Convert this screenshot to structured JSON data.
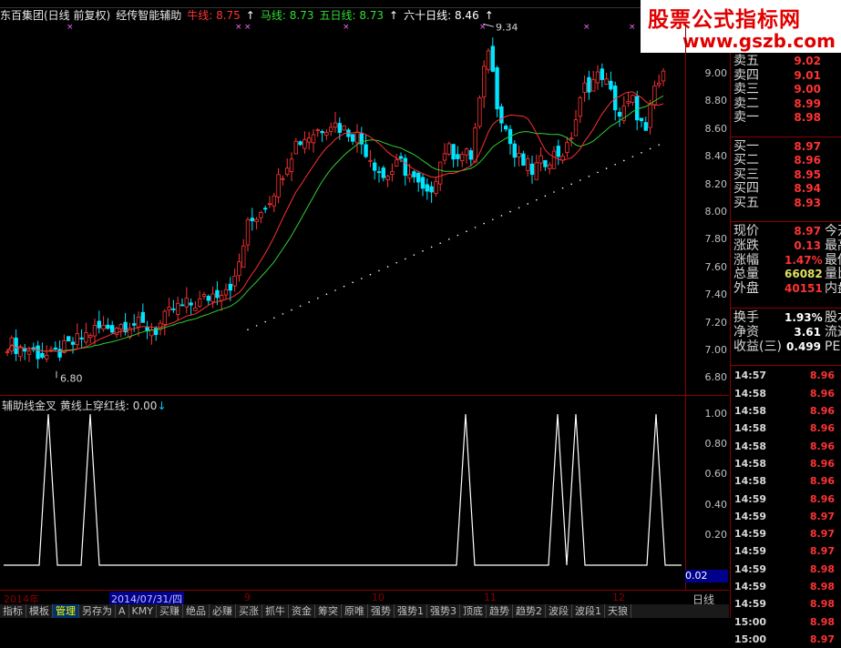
{
  "header": {
    "stock_name": "东百集团(日线 前复权)",
    "indicator_name": "经传智能辅助",
    "niu_label": "牛线:",
    "niu_value": "8.75",
    "ma_label": "马线:",
    "ma_value": "8.73",
    "wu_label": "五日线:",
    "wu_value": "8.73",
    "liushi_label": "六十日线:",
    "liushi_value": "8.46"
  },
  "watermark": {
    "line1": "股票公式指标网",
    "line2": "www.gszb.com"
  },
  "main_chart": {
    "price_axis": [
      "9.00",
      "8.80",
      "8.60",
      "8.40",
      "8.20",
      "8.00",
      "7.80",
      "7.60",
      "7.40",
      "7.20",
      "7.00",
      "6.80"
    ],
    "high_label": "9.34",
    "low_label": "6.80"
  },
  "sub_chart": {
    "title": "辅助线金叉",
    "line_label": "黄线上穿红线:",
    "line_value": "0.00",
    "axis": [
      "1.00",
      "0.80",
      "0.60",
      "0.40",
      "0.20"
    ],
    "current": "0.02"
  },
  "date_bar": {
    "year": "2014年",
    "cursor_date": "2014/07/31/四",
    "months": [
      "9",
      "10",
      "11",
      "12"
    ],
    "period": "日线"
  },
  "tabs": [
    "指标",
    "模板",
    "管理",
    "另存为",
    "A",
    "KMY",
    "买赚",
    "绝品",
    "必赚",
    "买涨",
    "抓牛",
    "资金",
    "筹突",
    "原唯",
    "强势",
    "强势1",
    "强势3",
    "顶底",
    "趋势",
    "趋势2",
    "波段",
    "波段1",
    "天狼"
  ],
  "active_tab": "管理",
  "panel": {
    "sell": [
      {
        "label": "卖五",
        "price": "9.02"
      },
      {
        "label": "卖四",
        "price": "9.01"
      },
      {
        "label": "卖三",
        "price": "9.00"
      },
      {
        "label": "卖二",
        "price": "8.99"
      },
      {
        "label": "卖一",
        "price": "8.98"
      }
    ],
    "buy": [
      {
        "label": "买一",
        "price": "8.97"
      },
      {
        "label": "买二",
        "price": "8.96"
      },
      {
        "label": "买三",
        "price": "8.95"
      },
      {
        "label": "买四",
        "price": "8.94"
      },
      {
        "label": "买五",
        "price": "8.93"
      }
    ],
    "stats": [
      {
        "label": "现价",
        "value": "8.97",
        "ext": "今开",
        "color": "#ff3333"
      },
      {
        "label": "涨跌",
        "value": "0.13",
        "ext": "最高",
        "color": "#ff3333"
      },
      {
        "label": "涨幅",
        "value": "1.47%",
        "ext": "最低",
        "color": "#ff3333"
      },
      {
        "label": "总量",
        "value": "66082",
        "ext": "量比",
        "color": "#e0e060"
      },
      {
        "label": "外盘",
        "value": "40151",
        "ext": "内盘",
        "color": "#ff3333"
      }
    ],
    "fin": [
      {
        "label": "换手",
        "value": "1.93%",
        "ext": "股本"
      },
      {
        "label": "净资",
        "value": "3.61",
        "ext": "流通"
      },
      {
        "label": "收益(三)",
        "value": "0.499",
        "ext": "PE(动)"
      }
    ],
    "ticks": [
      {
        "time": "14:57",
        "price": "8.96"
      },
      {
        "time": "14:58",
        "price": "8.96"
      },
      {
        "time": "14:58",
        "price": "8.96"
      },
      {
        "time": "14:58",
        "price": "8.96"
      },
      {
        "time": "14:58",
        "price": "8.96"
      },
      {
        "time": "14:58",
        "price": "8.96"
      },
      {
        "time": "14:58",
        "price": "8.96"
      },
      {
        "time": "14:59",
        "price": "8.96"
      },
      {
        "time": "14:59",
        "price": "8.97"
      },
      {
        "time": "14:59",
        "price": "8.97"
      },
      {
        "time": "14:59",
        "price": "8.97"
      },
      {
        "time": "14:59",
        "price": "8.98"
      },
      {
        "time": "14:59",
        "price": "8.98"
      },
      {
        "time": "14:59",
        "price": "8.98"
      },
      {
        "time": "15:00",
        "price": "8.98"
      },
      {
        "time": "15:00",
        "price": "8.97"
      }
    ]
  },
  "colors": {
    "up": "#ff3333",
    "down": "#00e5ff",
    "ma_red": "#ff3030",
    "ma_green": "#33cc33",
    "dotted": "#ffffff"
  },
  "signal_peaks": [
    0.0,
    1.0,
    1.0,
    0.0,
    1.0,
    1.0,
    1.0,
    1.0
  ]
}
